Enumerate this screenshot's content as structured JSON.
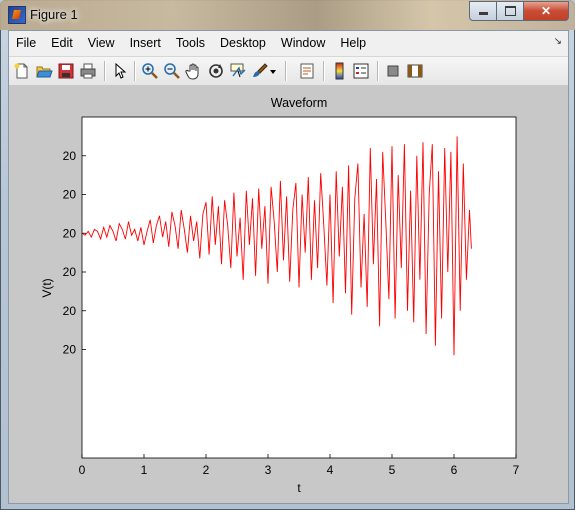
{
  "window": {
    "title": "Figure 1",
    "minimize_label": "minimize",
    "maximize_label": "maximize",
    "close_label": "close"
  },
  "menu": {
    "items": [
      "File",
      "Edit",
      "View",
      "Insert",
      "Tools",
      "Desktop",
      "Window",
      "Help"
    ],
    "dock_arrow": "↘"
  },
  "toolbar": {
    "icons": [
      "new-figure-icon",
      "open-file-icon",
      "save-figure-icon",
      "print-figure-icon",
      "edit-plot-arrow-icon",
      "zoom-in-icon",
      "zoom-out-icon",
      "pan-hand-icon",
      "rotate-3d-icon",
      "data-cursor-icon",
      "brush-icon",
      "brush-dropdown-icon",
      "link-plot-icon",
      "insert-colorbar-icon",
      "insert-legend-icon",
      "hide-plot-tools-icon",
      "show-plot-tools-icon"
    ]
  },
  "colors": {
    "line": "#ff0000",
    "plot_background": "#ffffff",
    "figure_background": "#c8c8c8"
  },
  "chart_data": {
    "type": "line",
    "title": "Waveform",
    "xlabel": "t",
    "ylabel": "V(t)",
    "xlim": [
      0,
      7
    ],
    "ylim": [
      -5.8,
      3
    ],
    "x_ticks": [
      "0",
      "1",
      "2",
      "3",
      "4",
      "5",
      "6",
      "7"
    ],
    "y_ticks": [
      "20",
      "20",
      "20",
      "20",
      "20",
      "20"
    ],
    "y_tick_values": [
      2,
      1,
      0,
      -1,
      -2,
      -3
    ],
    "grid": false,
    "legend": "none",
    "series": [
      {
        "x": [
          0,
          0.05,
          0.1,
          0.15,
          0.2,
          0.25,
          0.3,
          0.35,
          0.4,
          0.45,
          0.5,
          0.55,
          0.6,
          0.65,
          0.7,
          0.75,
          0.8,
          0.85,
          0.9,
          0.95,
          1,
          1.05,
          1.1,
          1.15,
          1.2,
          1.25,
          1.3,
          1.35,
          1.4,
          1.45,
          1.5,
          1.55,
          1.6,
          1.65,
          1.7,
          1.75,
          1.8,
          1.85,
          1.9,
          1.95,
          2,
          2.05,
          2.1,
          2.15,
          2.2,
          2.25,
          2.3,
          2.35,
          2.4,
          2.45,
          2.5,
          2.55,
          2.6,
          2.65,
          2.7,
          2.75,
          2.8,
          2.85,
          2.9,
          2.95,
          3,
          3.05,
          3.1,
          3.15,
          3.2,
          3.25,
          3.3,
          3.35,
          3.4,
          3.45,
          3.5,
          3.55,
          3.6,
          3.65,
          3.7,
          3.75,
          3.8,
          3.85,
          3.9,
          3.95,
          4,
          4.05,
          4.1,
          4.15,
          4.2,
          4.25,
          4.3,
          4.35,
          4.4,
          4.45,
          4.5,
          4.55,
          4.6,
          4.65,
          4.7,
          4.75,
          4.8,
          4.85,
          4.9,
          4.95,
          5,
          5.05,
          5.1,
          5.15,
          5.2,
          5.25,
          5.3,
          5.35,
          5.4,
          5.45,
          5.5,
          5.55,
          5.6,
          5.65,
          5.7,
          5.75,
          5.8,
          5.85,
          5.9,
          5.95,
          6,
          6.05,
          6.1,
          6.15,
          6.2,
          6.25,
          6.28
        ],
        "y": [
          0,
          -0.05,
          0.05,
          -0.1,
          0.1,
          0.05,
          -0.15,
          0.15,
          -0.1,
          0.2,
          0.05,
          -0.2,
          0.25,
          0.1,
          -0.15,
          0.3,
          -0.05,
          0.1,
          -0.2,
          0.15,
          -0.3,
          0.05,
          0.35,
          -0.25,
          0.2,
          0.45,
          -0.1,
          0.3,
          -0.35,
          0.55,
          0.2,
          -0.4,
          0.6,
          0.1,
          -0.5,
          0.45,
          -0.2,
          0.3,
          -0.65,
          0.5,
          0.8,
          -0.55,
          0.95,
          -0.3,
          0.7,
          -0.8,
          0.85,
          0.2,
          -0.9,
          1.05,
          -0.6,
          0.4,
          -1.2,
          1.1,
          -0.3,
          0.9,
          -1.1,
          1.15,
          -0.4,
          0.7,
          -1.3,
          1.2,
          0.3,
          -1.0,
          1.35,
          -0.7,
          0.95,
          -1.25,
          0.6,
          1.3,
          -1.4,
          1.0,
          -0.5,
          1.45,
          -1.2,
          0.85,
          -0.9,
          1.55,
          0.2,
          -1.35,
          1.0,
          -1.8,
          1.6,
          -0.6,
          1.2,
          -1.55,
          1.75,
          -2.1,
          0.9,
          1.8,
          -1.4,
          0.5,
          -1.9,
          2.2,
          -0.8,
          1.4,
          -2.4,
          2.1,
          0.3,
          -1.7,
          2.25,
          -2.2,
          1.5,
          -0.9,
          2.3,
          -2.0,
          1.1,
          -2.3,
          2.0,
          -1.2,
          2.35,
          -2.6,
          1.0,
          2.3,
          -2.9,
          1.6,
          -2.2,
          2.2,
          -1.0,
          2.1,
          -3.15,
          2.5,
          -2.0,
          1.8,
          -1.2,
          0.6,
          -0.4
        ]
      }
    ]
  }
}
